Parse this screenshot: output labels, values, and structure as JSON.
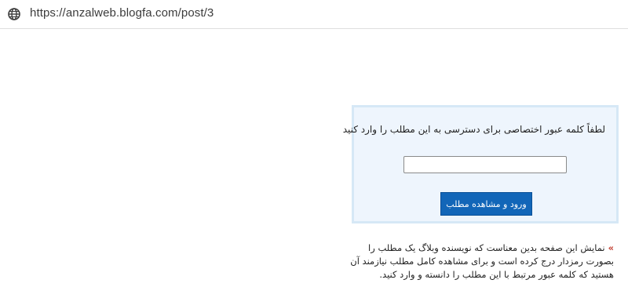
{
  "browser": {
    "url": "https://anzalweb.blogfa.com/post/3",
    "site_icon": "globe-icon"
  },
  "password_form": {
    "prompt": "لطفاً کلمه عبور اختصاصی برای دسترسی به این مطلب را وارد کنید",
    "password_value": "",
    "submit_label": "ورود و مشاهده مطلب"
  },
  "notice": {
    "marker": "»",
    "text": "نمایش این صفحه بدین معناست که نویسنده وبلاگ یک مطلب را بصورت رمزدار درج کرده است و برای مشاهده کامل مطلب نیازمند آن هستید که کلمه عبور مرتبط با این مطلب را دانسته و وارد کنید."
  },
  "colors": {
    "box_background": "#eef5fd",
    "box_border": "#d6e8f6",
    "button": "#1266b8",
    "marker": "#c0392b"
  }
}
